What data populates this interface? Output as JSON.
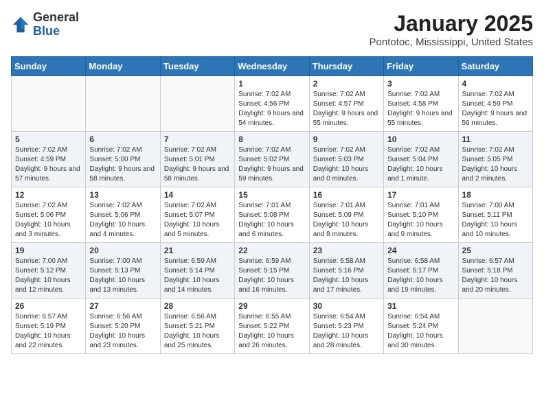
{
  "header": {
    "logo": {
      "general": "General",
      "blue": "Blue"
    },
    "title": "January 2025",
    "subtitle": "Pontotoc, Mississippi, United States"
  },
  "weekdays": [
    "Sunday",
    "Monday",
    "Tuesday",
    "Wednesday",
    "Thursday",
    "Friday",
    "Saturday"
  ],
  "weeks": [
    [
      {
        "day": null
      },
      {
        "day": null
      },
      {
        "day": null
      },
      {
        "day": 1,
        "sunrise": "Sunrise: 7:02 AM",
        "sunset": "Sunset: 4:56 PM",
        "daylight": "Daylight: 9 hours and 54 minutes."
      },
      {
        "day": 2,
        "sunrise": "Sunrise: 7:02 AM",
        "sunset": "Sunset: 4:57 PM",
        "daylight": "Daylight: 9 hours and 55 minutes."
      },
      {
        "day": 3,
        "sunrise": "Sunrise: 7:02 AM",
        "sunset": "Sunset: 4:58 PM",
        "daylight": "Daylight: 9 hours and 55 minutes."
      },
      {
        "day": 4,
        "sunrise": "Sunrise: 7:02 AM",
        "sunset": "Sunset: 4:59 PM",
        "daylight": "Daylight: 9 hours and 56 minutes."
      }
    ],
    [
      {
        "day": 5,
        "sunrise": "Sunrise: 7:02 AM",
        "sunset": "Sunset: 4:59 PM",
        "daylight": "Daylight: 9 hours and 57 minutes."
      },
      {
        "day": 6,
        "sunrise": "Sunrise: 7:02 AM",
        "sunset": "Sunset: 5:00 PM",
        "daylight": "Daylight: 9 hours and 58 minutes."
      },
      {
        "day": 7,
        "sunrise": "Sunrise: 7:02 AM",
        "sunset": "Sunset: 5:01 PM",
        "daylight": "Daylight: 9 hours and 58 minutes."
      },
      {
        "day": 8,
        "sunrise": "Sunrise: 7:02 AM",
        "sunset": "Sunset: 5:02 PM",
        "daylight": "Daylight: 9 hours and 59 minutes."
      },
      {
        "day": 9,
        "sunrise": "Sunrise: 7:02 AM",
        "sunset": "Sunset: 5:03 PM",
        "daylight": "Daylight: 10 hours and 0 minutes."
      },
      {
        "day": 10,
        "sunrise": "Sunrise: 7:02 AM",
        "sunset": "Sunset: 5:04 PM",
        "daylight": "Daylight: 10 hours and 1 minute."
      },
      {
        "day": 11,
        "sunrise": "Sunrise: 7:02 AM",
        "sunset": "Sunset: 5:05 PM",
        "daylight": "Daylight: 10 hours and 2 minutes."
      }
    ],
    [
      {
        "day": 12,
        "sunrise": "Sunrise: 7:02 AM",
        "sunset": "Sunset: 5:06 PM",
        "daylight": "Daylight: 10 hours and 3 minutes."
      },
      {
        "day": 13,
        "sunrise": "Sunrise: 7:02 AM",
        "sunset": "Sunset: 5:06 PM",
        "daylight": "Daylight: 10 hours and 4 minutes."
      },
      {
        "day": 14,
        "sunrise": "Sunrise: 7:02 AM",
        "sunset": "Sunset: 5:07 PM",
        "daylight": "Daylight: 10 hours and 5 minutes."
      },
      {
        "day": 15,
        "sunrise": "Sunrise: 7:01 AM",
        "sunset": "Sunset: 5:08 PM",
        "daylight": "Daylight: 10 hours and 6 minutes."
      },
      {
        "day": 16,
        "sunrise": "Sunrise: 7:01 AM",
        "sunset": "Sunset: 5:09 PM",
        "daylight": "Daylight: 10 hours and 8 minutes."
      },
      {
        "day": 17,
        "sunrise": "Sunrise: 7:01 AM",
        "sunset": "Sunset: 5:10 PM",
        "daylight": "Daylight: 10 hours and 9 minutes."
      },
      {
        "day": 18,
        "sunrise": "Sunrise: 7:00 AM",
        "sunset": "Sunset: 5:11 PM",
        "daylight": "Daylight: 10 hours and 10 minutes."
      }
    ],
    [
      {
        "day": 19,
        "sunrise": "Sunrise: 7:00 AM",
        "sunset": "Sunset: 5:12 PM",
        "daylight": "Daylight: 10 hours and 12 minutes."
      },
      {
        "day": 20,
        "sunrise": "Sunrise: 7:00 AM",
        "sunset": "Sunset: 5:13 PM",
        "daylight": "Daylight: 10 hours and 13 minutes."
      },
      {
        "day": 21,
        "sunrise": "Sunrise: 6:59 AM",
        "sunset": "Sunset: 5:14 PM",
        "daylight": "Daylight: 10 hours and 14 minutes."
      },
      {
        "day": 22,
        "sunrise": "Sunrise: 6:59 AM",
        "sunset": "Sunset: 5:15 PM",
        "daylight": "Daylight: 10 hours and 16 minutes."
      },
      {
        "day": 23,
        "sunrise": "Sunrise: 6:58 AM",
        "sunset": "Sunset: 5:16 PM",
        "daylight": "Daylight: 10 hours and 17 minutes."
      },
      {
        "day": 24,
        "sunrise": "Sunrise: 6:58 AM",
        "sunset": "Sunset: 5:17 PM",
        "daylight": "Daylight: 10 hours and 19 minutes."
      },
      {
        "day": 25,
        "sunrise": "Sunrise: 6:57 AM",
        "sunset": "Sunset: 5:18 PM",
        "daylight": "Daylight: 10 hours and 20 minutes."
      }
    ],
    [
      {
        "day": 26,
        "sunrise": "Sunrise: 6:57 AM",
        "sunset": "Sunset: 5:19 PM",
        "daylight": "Daylight: 10 hours and 22 minutes."
      },
      {
        "day": 27,
        "sunrise": "Sunrise: 6:56 AM",
        "sunset": "Sunset: 5:20 PM",
        "daylight": "Daylight: 10 hours and 23 minutes."
      },
      {
        "day": 28,
        "sunrise": "Sunrise: 6:56 AM",
        "sunset": "Sunset: 5:21 PM",
        "daylight": "Daylight: 10 hours and 25 minutes."
      },
      {
        "day": 29,
        "sunrise": "Sunrise: 6:55 AM",
        "sunset": "Sunset: 5:22 PM",
        "daylight": "Daylight: 10 hours and 26 minutes."
      },
      {
        "day": 30,
        "sunrise": "Sunrise: 6:54 AM",
        "sunset": "Sunset: 5:23 PM",
        "daylight": "Daylight: 10 hours and 28 minutes."
      },
      {
        "day": 31,
        "sunrise": "Sunrise: 6:54 AM",
        "sunset": "Sunset: 5:24 PM",
        "daylight": "Daylight: 10 hours and 30 minutes."
      },
      {
        "day": null
      }
    ]
  ]
}
